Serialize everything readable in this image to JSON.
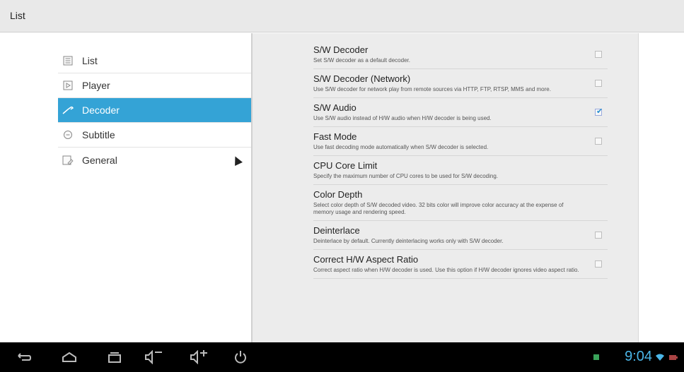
{
  "window": {
    "title": "List"
  },
  "sidebar": {
    "items": [
      {
        "label": "List",
        "icon": "list-icon"
      },
      {
        "label": "Player",
        "icon": "player-icon"
      },
      {
        "label": "Decoder",
        "icon": "decoder-icon",
        "selected": true
      },
      {
        "label": "Subtitle",
        "icon": "subtitle-icon"
      },
      {
        "label": "General",
        "icon": "general-icon"
      }
    ]
  },
  "prefs": {
    "items": [
      {
        "title": "S/W Decoder",
        "summary": "Set S/W decoder as a default decoder.",
        "checked": false
      },
      {
        "title": "S/W Decoder (Network)",
        "summary": "Use S/W decoder for network play from remote sources via HTTP, FTP, RTSP, MMS and more.",
        "checked": false
      },
      {
        "title": "S/W Audio",
        "summary": "Use S/W audio instead of H/W audio when H/W decoder is being used.",
        "checked": true
      },
      {
        "title": "Fast Mode",
        "summary": "Use fast decoding mode automatically when S/W decoder is selected.",
        "checked": false
      },
      {
        "title": "CPU Core Limit",
        "summary": "Specify the maximum number of CPU cores to be used for S/W decoding."
      },
      {
        "title": "Color Depth",
        "summary": "Select color depth of S/W decoded video. 32 bits color will improve color accuracy at the expense of memory usage and rendering speed."
      },
      {
        "title": "Deinterlace",
        "summary": "Deinterlace by default. Currently deinterlacing works only with S/W decoder.",
        "checked": false
      },
      {
        "title": "Correct H/W Aspect Ratio",
        "summary": "Correct aspect ratio when H/W decoder is used. Use this option if H/W decoder ignores video aspect ratio.",
        "checked": false
      }
    ]
  },
  "status_bar": {
    "time": "9:04"
  },
  "colors": {
    "accent": "#34a3d6",
    "clock": "#4bb6e8"
  }
}
